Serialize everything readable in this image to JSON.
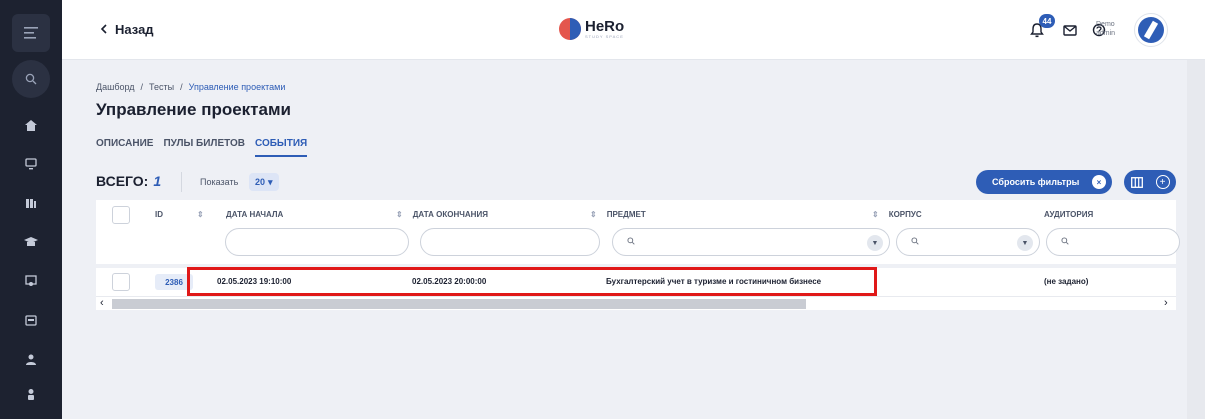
{
  "header": {
    "back_label": "Назад",
    "logo_text": "HeRo",
    "logo_sub": "STUDY SPACE",
    "notifications_count": "44",
    "user_line1": "Demo",
    "user_line2": "admin"
  },
  "breadcrumb": [
    "Дашборд",
    "/",
    "Тесты",
    "/",
    "Управление проектами"
  ],
  "page_title": "Управление проектами",
  "tabs": [
    {
      "label": "ОПИСАНИЕ",
      "active": false
    },
    {
      "label": "ПУЛЫ БИЛЕТОВ",
      "active": false
    },
    {
      "label": "СОБЫТИЯ",
      "active": true
    }
  ],
  "toolbar": {
    "total_label": "ВСЕГО:",
    "total_value": "1",
    "show_label": "Показать",
    "page_size": "20",
    "reset_label": "Сбросить фильтры",
    "reset_x": "×",
    "cols_plus": "+"
  },
  "table": {
    "columns": [
      "ID",
      "ДАТА НАЧАЛА",
      "ДАТА ОКОНЧАНИЯ",
      "ПРЕДМЕТ",
      "КОРПУС",
      "АУДИТОРИЯ"
    ],
    "rows": [
      {
        "id": "2386",
        "start": "02.05.2023 19:10:00",
        "end": "02.05.2023 20:00:00",
        "subject": "Бухгалтерский учет в туризме и гостиничном бизнесе",
        "building": "",
        "room": "(не задано)"
      }
    ]
  },
  "colors": {
    "accent": "#2e5db6",
    "rail": "#1d2230",
    "highlight": "#e01818"
  }
}
